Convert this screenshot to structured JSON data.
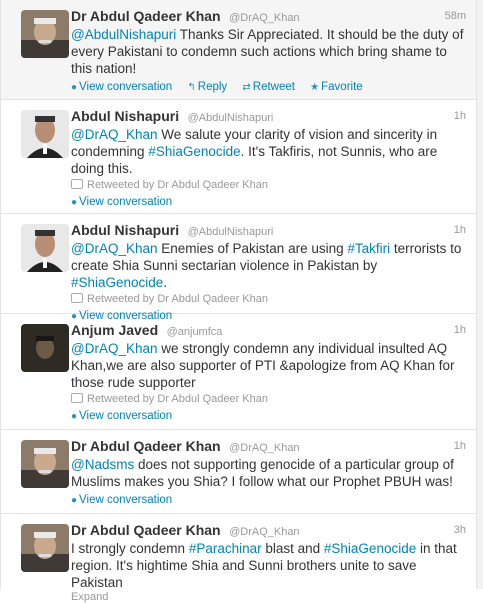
{
  "tweets": [
    {
      "name": "Dr Abdul Qadeer Khan",
      "handle": "@DrAQ_Khan",
      "time": "58m",
      "parts": [
        "@AbdulNishapuri",
        " Thanks Sir Appreciated. It should be the duty of every Pakistani to condemn such actions which bring shame to this nation!"
      ],
      "actions": {
        "view": "View conversation",
        "reply": "Reply",
        "retweet": "Retweet",
        "favorite": "Favorite"
      }
    },
    {
      "name": "Abdul Nishapuri",
      "handle": "@AbdulNishapuri",
      "time": "1h",
      "parts": [
        "@DrAQ_Khan",
        " We salute your clarity of vision and sincerity in condemning ",
        "#ShiaGenocide",
        ". It's Takfiris, not Sunnis, who are doing this."
      ],
      "retweeted": "Retweeted by Dr Abdul Qadeer Khan",
      "view": "View conversation"
    },
    {
      "name": "Abdul Nishapuri",
      "handle": "@AbdulNishapuri",
      "time": "1h",
      "parts": [
        "@DrAQ_Khan",
        " Enemies of Pakistan are using ",
        "#Takfiri",
        " terrorists to create Shia Sunni sectarian violence in Pakistan by ",
        "#ShiaGenocide",
        "."
      ],
      "retweeted": "Retweeted by Dr Abdul Qadeer Khan",
      "view": "View conversation"
    },
    {
      "name": "Anjum Javed",
      "handle": "@anjumfca",
      "time": "1h",
      "parts": [
        "@DrAQ_Khan",
        " we strongly condemn any individual insulted AQ Khan,we are also supporter of PTI &apologize from AQ Khan for those rude supporter"
      ],
      "retweeted": "Retweeted by Dr Abdul Qadeer Khan",
      "view": "View conversation"
    },
    {
      "name": "Dr Abdul Qadeer Khan",
      "handle": "@DrAQ_Khan",
      "time": "1h",
      "parts": [
        "@Nadsms",
        " does not supporting genocide of a particular group of Muslims makes you Shia? I follow what our Prophet PBUH was!"
      ],
      "view": "View conversation"
    },
    {
      "name": "Dr Abdul Qadeer Khan",
      "handle": "@DrAQ_Khan",
      "time": "3h",
      "parts": [
        "I strongly condemn ",
        "#Parachinar",
        " blast and ",
        "#ShiaGenocide",
        " in that region. It's hightime Shia and Sunni brothers unite to save Pakistan"
      ],
      "expand": "Expand"
    }
  ]
}
